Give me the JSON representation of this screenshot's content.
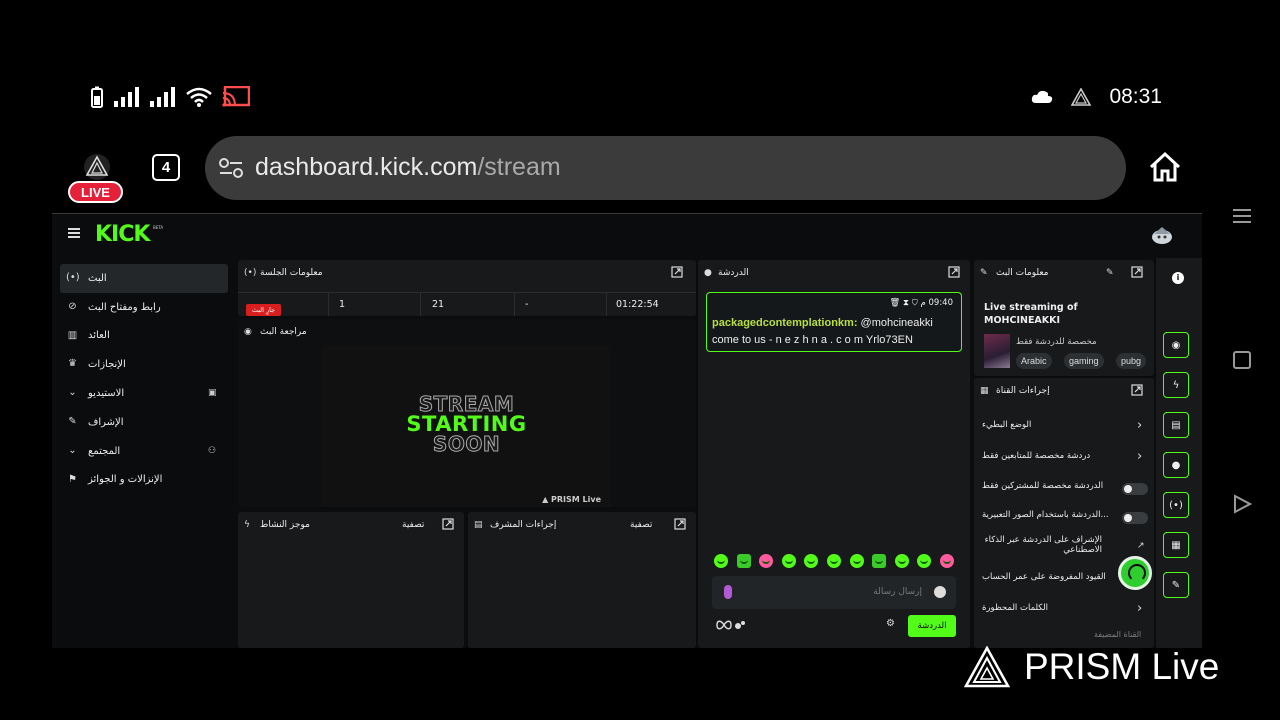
{
  "status_bar": {
    "time": "08:31"
  },
  "browser": {
    "live_badge": "LIVE",
    "tab_count": "4",
    "url_host": "dashboard.kick.com",
    "url_path": "/stream"
  },
  "kick": {
    "logo": "KICK",
    "beta": "BETA",
    "sidebar": [
      {
        "label": "البث",
        "icon": "broadcast-icon",
        "active": true
      },
      {
        "label": "رابط ومفتاح البث",
        "icon": "link-icon"
      },
      {
        "label": "العائد",
        "icon": "chart-icon"
      },
      {
        "label": "الإنجازات",
        "icon": "trophy-icon"
      },
      {
        "label": "الاستيديو",
        "icon": "chevron-down-icon"
      },
      {
        "label": "الإشراف",
        "icon": "wrench-icon"
      },
      {
        "label": "المجتمع",
        "icon": "chevron-down-icon"
      },
      {
        "label": "الإنزالات و الجوائز",
        "icon": "gift-icon"
      }
    ],
    "session": {
      "title": "معلومات الجلسة",
      "live_label": "جارٍ البث",
      "viewers": "1",
      "followers": "21",
      "subs": "-",
      "uptime": "01:22:54"
    },
    "preview": {
      "title": "مراجعة البث",
      "line1": "STREAM",
      "line2": "STARTING",
      "line3": "SOON",
      "watermark": "PRISM Live"
    },
    "activity": {
      "title": "موجز النشاط",
      "filter": "تصفية"
    },
    "mod_actions": {
      "title": "إجراءات المشرف",
      "filter": "تصفية"
    },
    "chat": {
      "title": "الدردشة",
      "message_time": "09:40 م",
      "message_user": "packagedcontemplationkm:",
      "message_text": "@mohcineakki come to us - n e z h n a . c o m Yrlo73EN",
      "input_placeholder": "إرسال رسالة",
      "send_label": "الدردشة"
    },
    "stream_info": {
      "title": "معلومات البث",
      "stream_title": "Live streaming of MOHCINEAKKI",
      "category": "مخصصة للدردشة فقط",
      "tags": [
        "Arabic",
        "gaming",
        "pubg"
      ]
    },
    "channel_actions": {
      "title": "إجراءات القناة",
      "items": [
        {
          "label": "الوضع البطيء",
          "kind": "chevron"
        },
        {
          "label": "دردشة مخصصة للمتابعين فقط",
          "kind": "chevron"
        },
        {
          "label": "الدردشة مخصصة للمشتركين فقط",
          "kind": "toggle"
        },
        {
          "label": "...الدردشة باستخدام الصور التعبيرية",
          "kind": "toggle"
        },
        {
          "label": "الإشراف على الدردشة عبر الذكاء الاصطناعي",
          "kind": "link"
        },
        {
          "label": "القيود المفروضة على عمر الحساب",
          "kind": "chevron"
        },
        {
          "label": "الكلمات المحظورة",
          "kind": "chevron"
        }
      ],
      "footer": "القناة المضيفة"
    }
  },
  "brand_overlay": {
    "text": "PRISM Live"
  }
}
